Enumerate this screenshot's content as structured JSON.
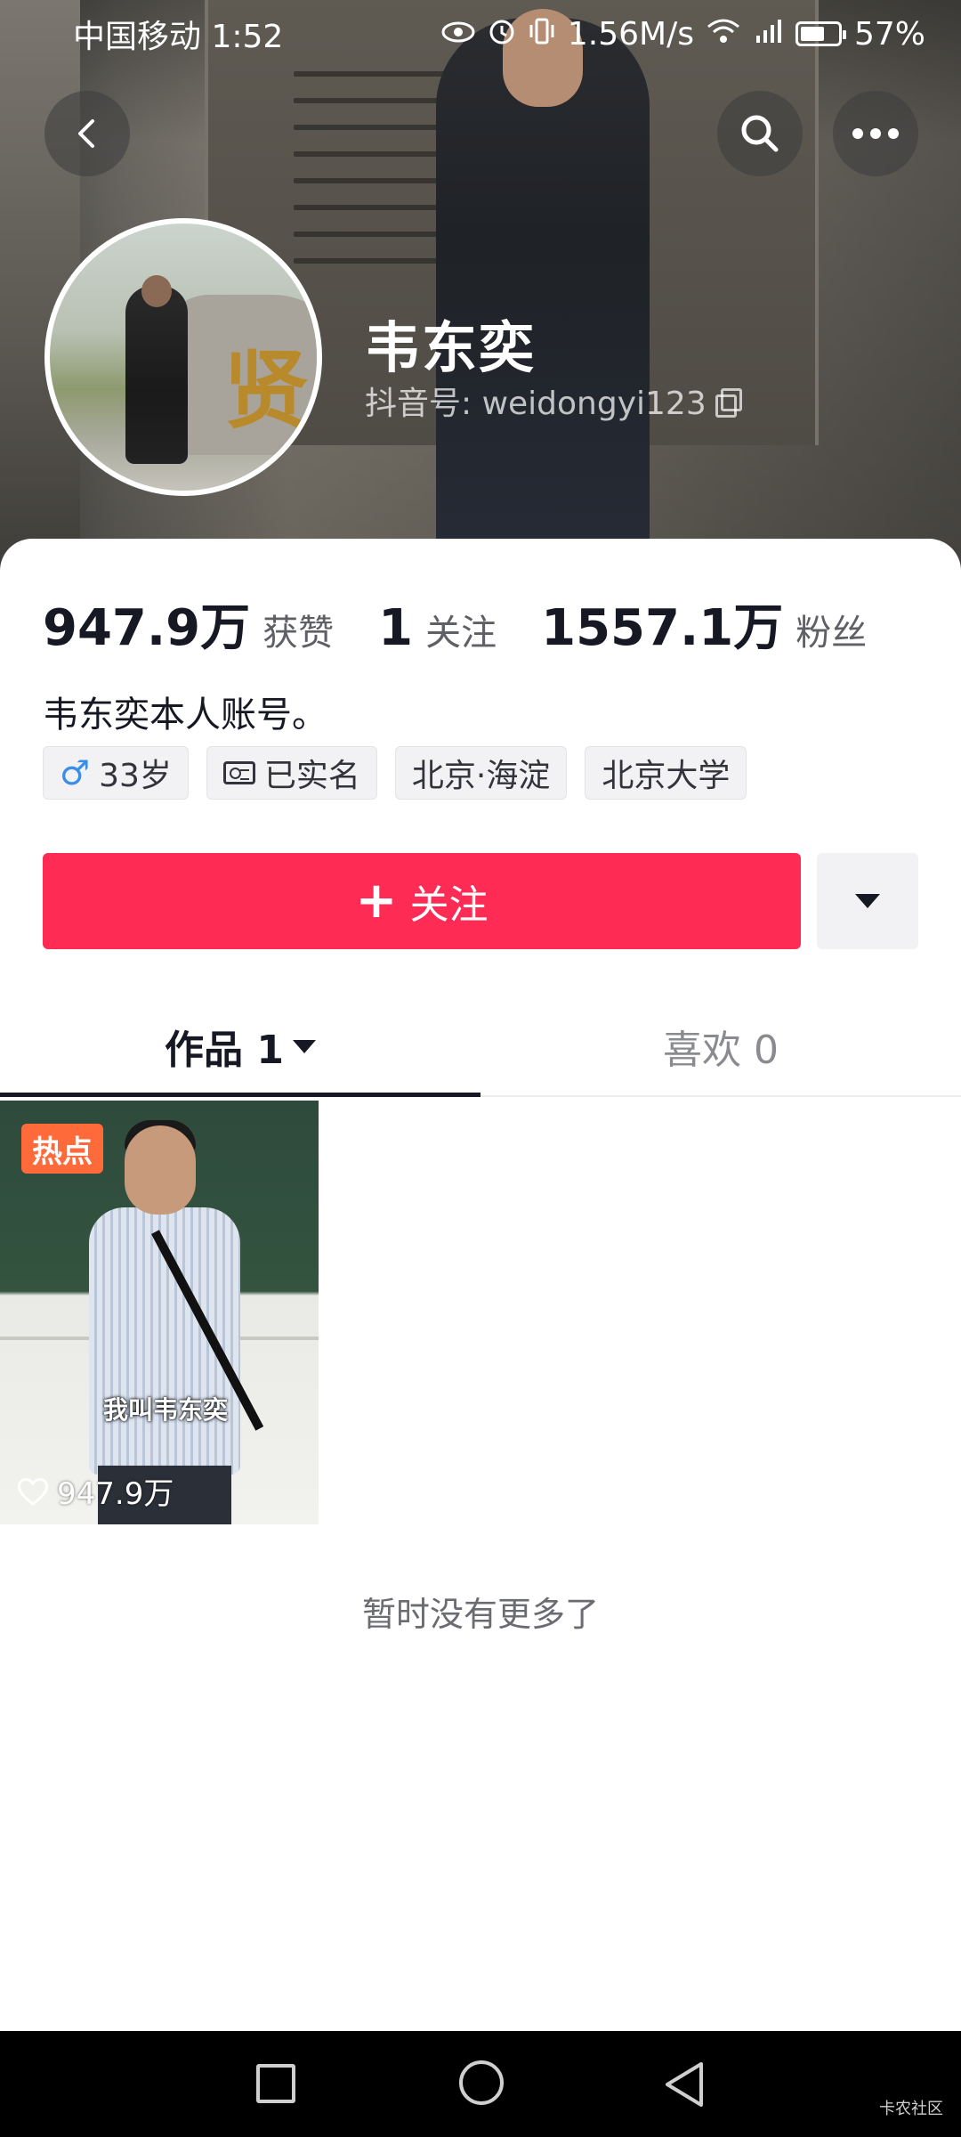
{
  "status_bar": {
    "carrier_time": "中国移动 1:52",
    "net_speed": "1.56M/s",
    "battery": "57%",
    "icons": [
      "eye-icon",
      "alarm-icon",
      "vibrate-icon",
      "wifi-icon",
      "signal-5g-icon",
      "battery-icon"
    ]
  },
  "header": {
    "back_icon": "chevron-left-icon",
    "search_icon": "search-icon",
    "more_icon": "more-dots-icon"
  },
  "profile": {
    "name": "韦东奕",
    "douyin_id_label": "抖音号: weidongyi123",
    "bio": "韦东奕本人账号。",
    "avatar_seal_char": "贤"
  },
  "stats": [
    {
      "value": "947.9万",
      "label": "获赞"
    },
    {
      "value": "1",
      "label": "关注"
    },
    {
      "value": "1557.1万",
      "label": "粉丝"
    }
  ],
  "tags": [
    {
      "icon": "male-icon",
      "glyph": "♂",
      "label": "33岁"
    },
    {
      "icon": "id-card-icon",
      "label": "已实名"
    },
    {
      "label": "北京·海淀"
    },
    {
      "label": "北京大学"
    }
  ],
  "actions": {
    "follow_label": "关注",
    "follow_plus": "+",
    "colors": {
      "follow_bg": "#fe2c55"
    }
  },
  "tabs": [
    {
      "label": "作品 1",
      "active": true
    },
    {
      "label": "喜欢 0",
      "active": false
    }
  ],
  "videos": [
    {
      "badge": "热点",
      "caption": "我叫韦东奕",
      "likes": "947.9万"
    }
  ],
  "footer_text": "暂时没有更多了",
  "watermark": "卡农社区"
}
